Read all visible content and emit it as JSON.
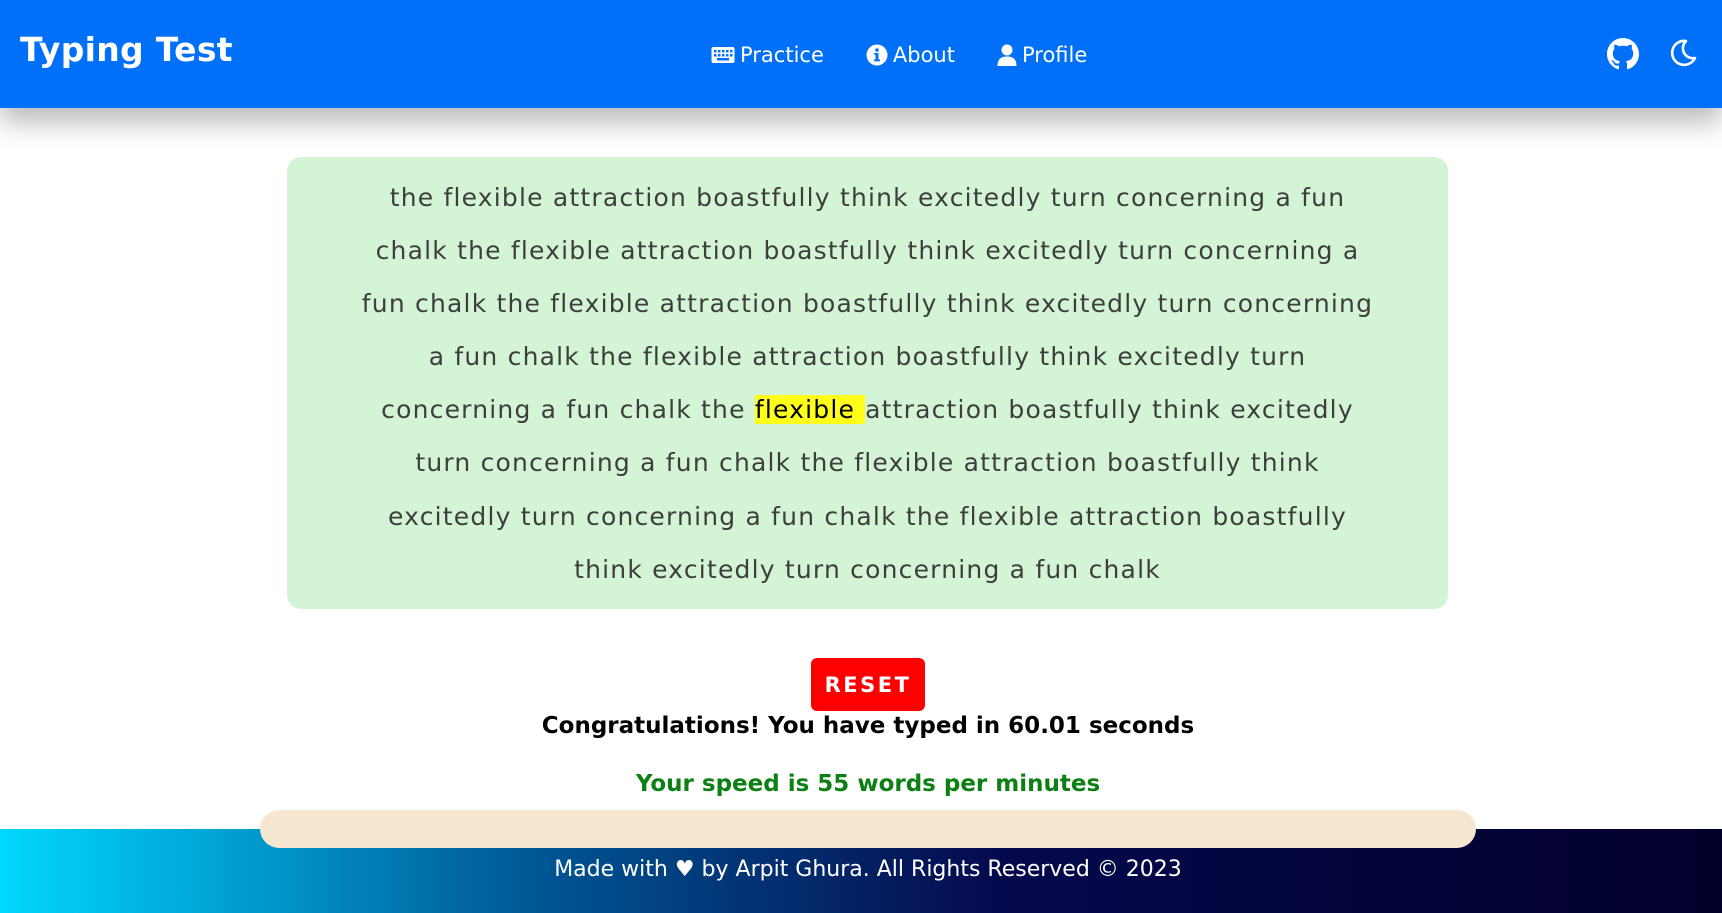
{
  "header": {
    "brand": "Typing Test",
    "nav": [
      {
        "label": "Practice",
        "icon": "keyboard-icon"
      },
      {
        "label": "About",
        "icon": "info-icon"
      },
      {
        "label": "Profile",
        "icon": "user-icon"
      }
    ],
    "right_icons": [
      "github-icon",
      "moon-icon"
    ]
  },
  "typing": {
    "lines": [
      "the flexible attraction boastfully think excitedly turn concerning a fun",
      "chalk the flexible attraction boastfully think excitedly turn concerning a",
      "fun chalk the flexible attraction boastfully think excitedly turn concerning",
      "a fun chalk the flexible attraction boastfully think excitedly turn",
      {
        "before": "concerning a fun chalk the ",
        "current": "flexible",
        "after": "attraction boastfully think excitedly"
      },
      "turn concerning a fun chalk the flexible attraction boastfully think",
      "excitedly turn concerning a fun chalk the flexible attraction boastfully",
      "think excitedly turn concerning a fun chalk"
    ]
  },
  "controls": {
    "reset_label": "RESET"
  },
  "result": {
    "message": "Congratulations! You have typed in 60.01 seconds",
    "speed": "Your speed is 55 words per minutes"
  },
  "footer": {
    "text": "Made with ♥ by Arpit Ghura. All Rights Reserved © 2023"
  },
  "colors": {
    "navbar": "#0070f8",
    "text_box": "#d3f5d6",
    "highlight": "#ffff1a",
    "reset": "#ff0000",
    "speed_text": "#0d8014",
    "footer_bar": "#f7e6d0"
  }
}
